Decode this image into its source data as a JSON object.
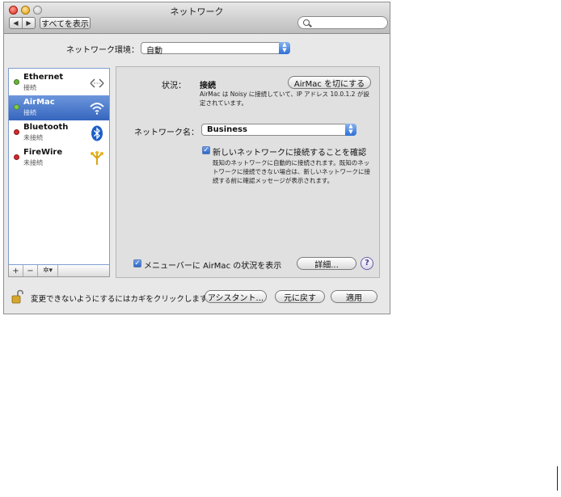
{
  "window": {
    "title": "ネットワーク"
  },
  "toolbar": {
    "back": "◀",
    "forward": "▶",
    "show_all": "すべてを表示",
    "search_placeholder": ""
  },
  "location": {
    "label": "ネットワーク環境：",
    "value": "自動"
  },
  "services": [
    {
      "name": "Ethernet",
      "status": "接続",
      "dot_color": "#6ab43a",
      "icon": "ethernet-arrows-icon"
    },
    {
      "name": "AirMac",
      "status": "接続",
      "dot_color": "#7ed04a",
      "icon": "wifi-icon",
      "selected": true
    },
    {
      "name": "Bluetooth",
      "status": "未接続",
      "dot_color": "#d02a2a",
      "icon": "bluetooth-icon"
    },
    {
      "name": "FireWire",
      "status": "未接続",
      "dot_color": "#d02a2a",
      "icon": "firewire-icon"
    }
  ],
  "sidebar_tools": {
    "add": "+",
    "remove": "−",
    "action": "✲▾"
  },
  "detail": {
    "status_label": "状況：",
    "status_value": "接続",
    "turn_off_button": "AirMac を切にする",
    "status_description": "AirMac は Noisy に接続していて、IP アドレス 10.0.1.2 が設定されています。",
    "network_name_label": "ネットワーク名：",
    "network_name_value": "Business",
    "ask_to_join_label": "新しいネットワークに接続することを確認",
    "ask_to_join_desc": "既知のネットワークに自動的に接続されます。既知のネットワークに接続できない場合は、新しいネットワークに接続する前に確認メッセージが表示されます。",
    "show_in_menubar_label": "メニューバーに AirMac の状況を表示",
    "advanced_button": "詳細...",
    "help": "?"
  },
  "footer": {
    "lock_text": "変更できないようにするにはカギをクリックします。",
    "assistant_button": "アシスタント...",
    "revert_button": "元に戻す",
    "apply_button": "適用"
  },
  "colors": {
    "selection": "#3d6fc6",
    "accent": "#2c6fd6"
  }
}
